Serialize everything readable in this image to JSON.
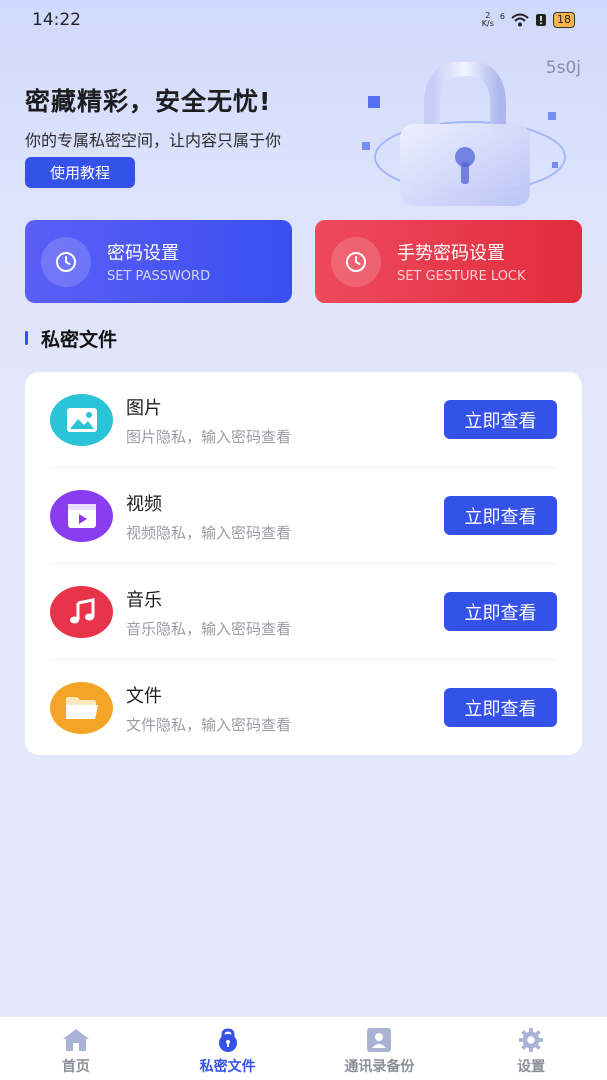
{
  "status_bar": {
    "time": "14:22",
    "net_speed_top": "2",
    "net_speed_unit": "K/s",
    "signal_label": "6",
    "battery": "18"
  },
  "watermark": "5s0j",
  "hero": {
    "title": "密藏精彩，安全无忧!",
    "subtitle": "你的专属私密空间，让内容只属于你",
    "tutorial_button": "使用教程"
  },
  "action_cards": [
    {
      "title": "密码设置",
      "subtitle": "SET PASSWORD",
      "icon": "clock-icon",
      "color": "#4a55f4"
    },
    {
      "title": "手势密码设置",
      "subtitle": "SET GESTURE LOCK",
      "icon": "clock-icon",
      "color": "#e63a4b"
    }
  ],
  "section": {
    "title": "私密文件"
  },
  "private_items": [
    {
      "title": "图片",
      "desc": "图片隐私，输入密码查看",
      "button": "立即查看",
      "icon": "image-icon",
      "color": "#2bc4d6"
    },
    {
      "title": "视频",
      "desc": "视频隐私，输入密码查看",
      "button": "立即查看",
      "icon": "video-icon",
      "color": "#8a3df0"
    },
    {
      "title": "音乐",
      "desc": "音乐隐私，输入密码查看",
      "button": "立即查看",
      "icon": "music-icon",
      "color": "#e8344a"
    },
    {
      "title": "文件",
      "desc": "文件隐私，输入密码查看",
      "button": "立即查看",
      "icon": "folder-icon",
      "color": "#f3a52a"
    }
  ],
  "tabbar": {
    "items": [
      {
        "label": "首页",
        "icon": "home-icon",
        "active": false
      },
      {
        "label": "私密文件",
        "icon": "lock-icon",
        "active": true
      },
      {
        "label": "通讯录备份",
        "icon": "contacts-icon",
        "active": false
      },
      {
        "label": "设置",
        "icon": "gear-icon",
        "active": false
      }
    ]
  },
  "colors": {
    "accent": "#3452e8"
  }
}
